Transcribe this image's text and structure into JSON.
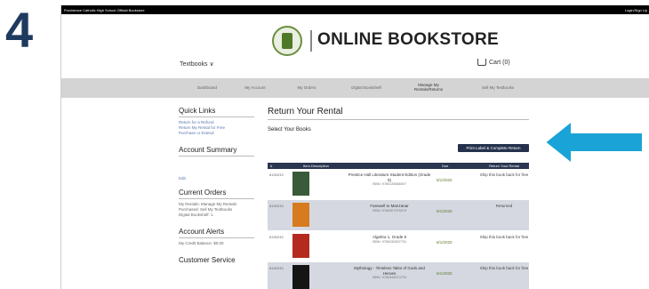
{
  "step_number": "4",
  "topbar": {
    "site_name": "Providence Catholic High School Official Bookstore",
    "login": "Login/Sign Up"
  },
  "header": {
    "brand": "ONLINE BOOKSTORE",
    "textbooks_menu": "Textbooks ∨",
    "cart": "Cart (0)"
  },
  "nav": {
    "items": [
      "Dashboard",
      "My Account",
      "My Orders",
      "Digital Bookshelf",
      "Manage My Rentals/Returns",
      "Sell My Textbooks"
    ]
  },
  "sidebar": {
    "quick_links_title": "Quick Links",
    "quick_links": [
      "Return for a Refund",
      "Return My Rental for Free",
      "Purchase or Extend"
    ],
    "account_summary_title": "Account Summary",
    "edit": "Edit",
    "current_orders_title": "Current Orders",
    "current_orders_text": [
      "My Rentals: Manage My Rentals",
      "Purchased: Sell My Textbooks",
      "Digital Bookshelf: 1"
    ],
    "account_alerts_title": "Account Alerts",
    "account_alerts_text": "My Credit Balance: $0.00",
    "customer_service_title": "Customer Service"
  },
  "main": {
    "title": "Return Your Rental",
    "subtitle": "Select Your Books",
    "print_button": "Print Label & Complete Return",
    "table_headers": [
      "#",
      "Item Description",
      "Due",
      "Return Your Rental"
    ],
    "rows": [
      {
        "id": "8190233",
        "title": "Prentice Hall Literature Student Edition (Grade 9)",
        "isbn": "ISBN: 9780133666007",
        "due": "6/1/2020",
        "status": "Ship this book back for free",
        "cover_color": "#3a5a3a"
      },
      {
        "id": "8190233",
        "title": "Farewell to Manzanar",
        "isbn": "ISBN: 9780307976079",
        "due": "6/1/2020",
        "status": "Returned",
        "cover_color": "#d87a1e"
      },
      {
        "id": "8190233",
        "title": "Algebra 1, Grade 9",
        "isbn": "ISBN: 9780030837751",
        "due": "6/1/2020",
        "status": "Ship this book back for free",
        "cover_color": "#b52a1e"
      },
      {
        "id": "8190233",
        "title": "Mythology - Timeless Tales of Gods and Heroes",
        "isbn": "ISBN: 9780446574754",
        "due": "6/1/2020",
        "status": "Ship this book back for free",
        "cover_color": "#151515"
      }
    ]
  },
  "colors": {
    "nav_bg": "#d3d4d3",
    "table_header": "#2a3550",
    "button_bg": "#24314c",
    "arrow": "#1aa3d6",
    "step_number": "#1f3a5f",
    "row_alt": "#d5d8e0"
  }
}
